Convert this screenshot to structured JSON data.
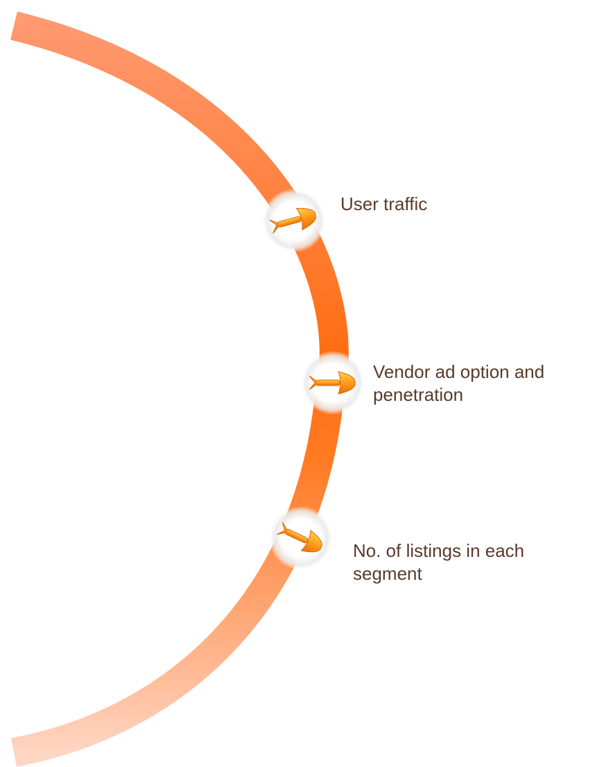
{
  "diagram": {
    "items": [
      {
        "label_lines": [
          "User traffic"
        ],
        "arrow_icon": "orange-arrow-icon"
      },
      {
        "label_lines": [
          "Vendor ad option and",
          "penetration"
        ],
        "arrow_icon": "orange-arrow-icon"
      },
      {
        "label_lines": [
          "No. of listings in each",
          "segment"
        ],
        "arrow_icon": "orange-arrow-icon"
      }
    ],
    "colors": {
      "arc_light": "#ffcfba",
      "arc_mid": "#ff9a66",
      "arc_strong": "#ff6a10",
      "label_text": "#5a3a2a",
      "node_fill": "#ffffff",
      "arrow_fill": "#ff9a20"
    }
  }
}
